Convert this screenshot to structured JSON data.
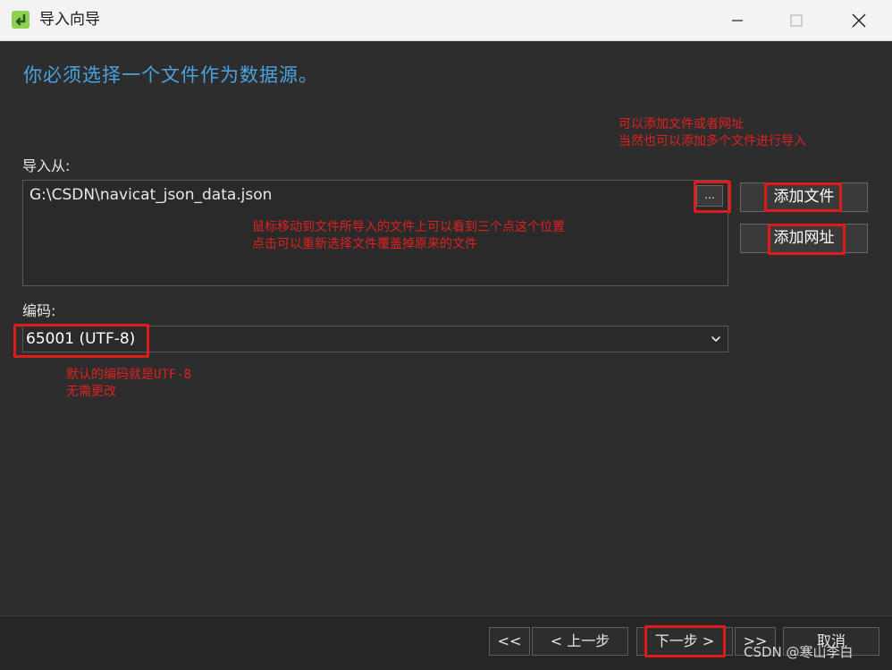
{
  "window": {
    "title": "导入向导",
    "icon": "import-wizard-icon",
    "controls": [
      "minimize-icon",
      "maximize-icon",
      "close-icon"
    ]
  },
  "main": {
    "heading": "你必须选择一个文件作为数据源。",
    "import_from_label": "导入从:",
    "files": [
      "G:\\CSDN\\navicat_json_data.json"
    ],
    "browse_label": "...",
    "add_file_label": "添加文件",
    "add_url_label": "添加网址",
    "encoding_label": "编码:",
    "encoding_value": "65001 (UTF-8)"
  },
  "annotations": {
    "add_hint": "可以添加文件或者网址\n当然也可以添加多个文件进行导入",
    "browse_hint": "鼠标移动到文件所导入的文件上可以看到三个点这个位置\n点击可以重新选择文件覆盖掉原来的文件",
    "encoding_hint": "默认的编码就是UTF-8\n无需更改"
  },
  "footer": {
    "first_label": "<<",
    "prev_label": "< 上一步",
    "next_label": "下一步 >",
    "last_label": ">>",
    "cancel_label": "取消"
  },
  "watermark": "CSDN @寒山李白",
  "colors": {
    "accent": "#4aa3df",
    "annotation": "#e02020",
    "background": "#2d2d2d"
  }
}
